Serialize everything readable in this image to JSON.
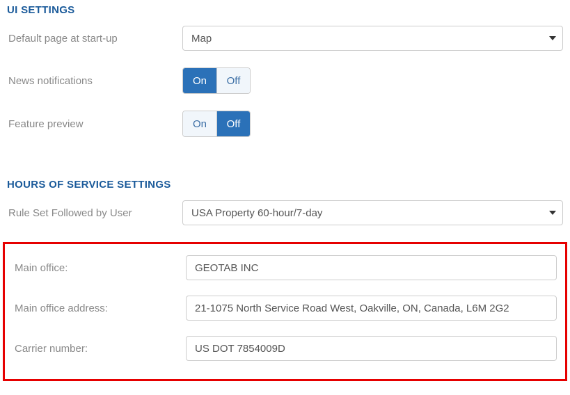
{
  "ui_settings": {
    "header": "UI SETTINGS",
    "default_page_label": "Default page at start-up",
    "default_page_value": "Map",
    "news_notifications_label": "News notifications",
    "feature_preview_label": "Feature preview",
    "toggle_on": "On",
    "toggle_off": "Off",
    "news_notifications_state": "on",
    "feature_preview_state": "off"
  },
  "hos_settings": {
    "header": "HOURS OF SERVICE SETTINGS",
    "rule_set_label": "Rule Set Followed by User",
    "rule_set_value": "USA Property 60-hour/7-day",
    "main_office_label": "Main office:",
    "main_office_value": "GEOTAB INC",
    "main_office_address_label": "Main office address:",
    "main_office_address_value": "21-1075 North Service Road West, Oakville, ON, Canada, L6M 2G2",
    "carrier_number_label": "Carrier number:",
    "carrier_number_value": "US DOT 7854009D"
  }
}
